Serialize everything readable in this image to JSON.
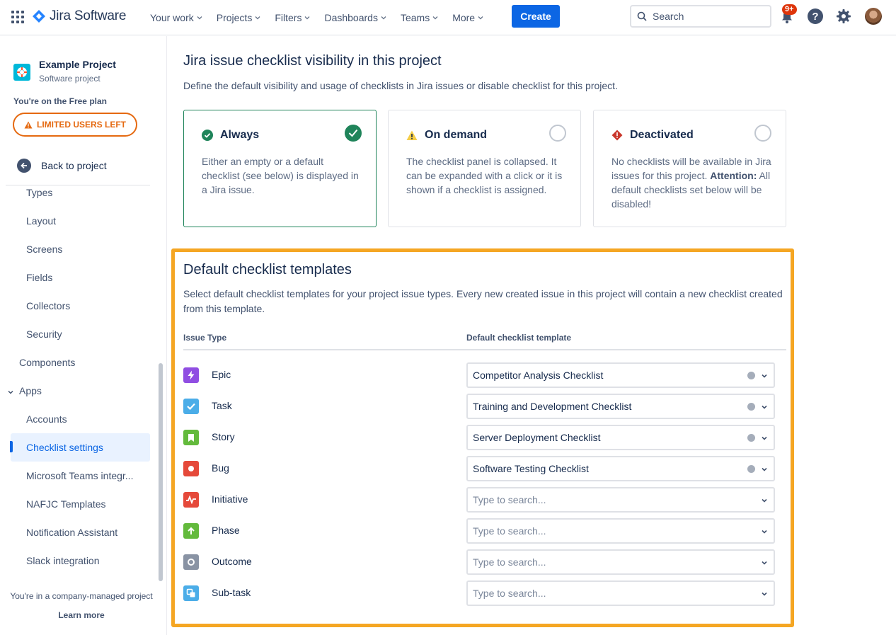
{
  "topnav": {
    "product": "Jira Software",
    "items": [
      "Your work",
      "Projects",
      "Filters",
      "Dashboards",
      "Teams",
      "More"
    ],
    "create": "Create",
    "search_placeholder": "Search",
    "notification_badge": "9+",
    "help_glyph": "?"
  },
  "sidebar": {
    "project_name": "Example Project",
    "project_type": "Software project",
    "plan": "You're on the Free plan",
    "limited_btn": "LIMITED USERS LEFT",
    "back": "Back to project",
    "items": [
      {
        "label": "Types"
      },
      {
        "label": "Layout"
      },
      {
        "label": "Screens"
      },
      {
        "label": "Fields"
      },
      {
        "label": "Collectors"
      },
      {
        "label": "Security"
      },
      {
        "label": "Components"
      },
      {
        "label": "Apps"
      },
      {
        "label": "Accounts"
      },
      {
        "label": "Checklist settings"
      },
      {
        "label": "Microsoft Teams integr..."
      },
      {
        "label": "NAFJC Templates"
      },
      {
        "label": "Notification Assistant"
      },
      {
        "label": "Slack integration"
      }
    ],
    "footer": "You're in a company-managed project",
    "learn_more": "Learn more"
  },
  "visibility": {
    "title": "Jira issue checklist visibility in this project",
    "description": "Define the default visibility and usage of checklists in Jira issues or disable checklist for this project.",
    "options": [
      {
        "title": "Always",
        "body": "Either an empty or a default checklist (see below) is displayed in a Jira issue.",
        "selected": true
      },
      {
        "title": "On demand",
        "body": "The checklist panel is collapsed. It can be expanded with a click or it is shown if a checklist is assigned.",
        "selected": false
      },
      {
        "title": "Deactivated",
        "body_prefix": "No checklists will be available in Jira issues for this project.",
        "attention_label": "Attention:",
        "body_suffix": "All default checklists set below will be disabled!",
        "selected": false
      }
    ]
  },
  "templates": {
    "title": "Default checklist templates",
    "description": "Select default checklist templates for your project issue types. Every new created issue in this project will contain a new checklist created from this template.",
    "col_issue_type": "Issue Type",
    "col_template": "Default checklist template",
    "placeholder": "Type to search...",
    "rows": [
      {
        "type": "Epic",
        "icon": "epic-icon",
        "color": "#904ee2",
        "value": "Competitor Analysis Checklist"
      },
      {
        "type": "Task",
        "icon": "task-icon",
        "color": "#4bade8",
        "value": "Training and Development Checklist"
      },
      {
        "type": "Story",
        "icon": "story-icon",
        "color": "#63ba3c",
        "value": "Server Deployment Checklist"
      },
      {
        "type": "Bug",
        "icon": "bug-icon",
        "color": "#e5493a",
        "value": "Software Testing Checklist"
      },
      {
        "type": "Initiative",
        "icon": "initiative-icon",
        "color": "#e5493a",
        "value": ""
      },
      {
        "type": "Phase",
        "icon": "phase-icon",
        "color": "#63ba3c",
        "value": ""
      },
      {
        "type": "Outcome",
        "icon": "outcome-icon",
        "color": "#8993a4",
        "value": ""
      },
      {
        "type": "Sub-task",
        "icon": "subtask-icon",
        "color": "#4bade8",
        "value": ""
      }
    ]
  },
  "colors": {
    "accent": "#0c66e4",
    "selected_border": "#1f845a",
    "highlight_box": "#f5a623",
    "warning": "#e56910"
  }
}
